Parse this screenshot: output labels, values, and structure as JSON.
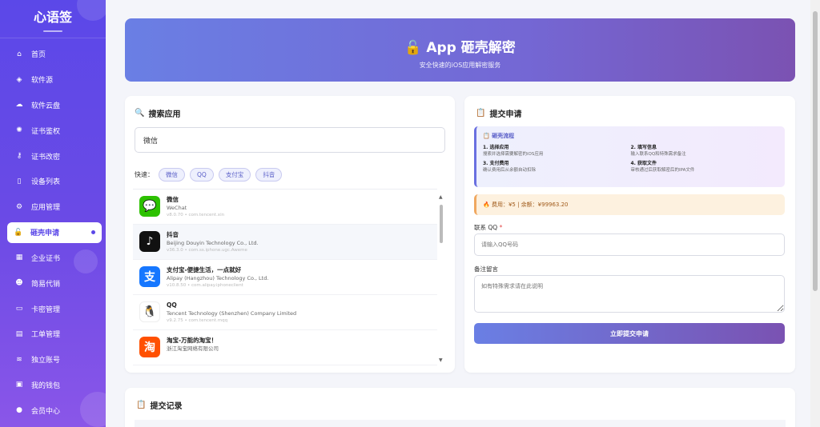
{
  "sidebar": {
    "logo": "心语签",
    "items": [
      {
        "label": "首页",
        "icon": "home-icon",
        "glyph": "⌂"
      },
      {
        "label": "软件源",
        "icon": "box-icon",
        "glyph": "◈"
      },
      {
        "label": "软件云盘",
        "icon": "cloud-icon",
        "glyph": "☁"
      },
      {
        "label": "证书鉴权",
        "icon": "certificate-icon",
        "glyph": "✺"
      },
      {
        "label": "证书改密",
        "icon": "key-icon",
        "glyph": "⚷"
      },
      {
        "label": "设备列表",
        "icon": "phone-icon",
        "glyph": "▯"
      },
      {
        "label": "应用管理",
        "icon": "apps-icon",
        "glyph": "⚙"
      },
      {
        "label": "砸壳申请",
        "icon": "unlock-icon",
        "glyph": "🔓",
        "active": true
      },
      {
        "label": "企业证书",
        "icon": "building-icon",
        "glyph": "▦"
      },
      {
        "label": "简易代销",
        "icon": "users-icon",
        "glyph": "☻"
      },
      {
        "label": "卡密管理",
        "icon": "card-icon",
        "glyph": "▭"
      },
      {
        "label": "工单管理",
        "icon": "ticket-icon",
        "glyph": "▤"
      },
      {
        "label": "独立账号",
        "icon": "layers-icon",
        "glyph": "≋"
      },
      {
        "label": "我的钱包",
        "icon": "wallet-icon",
        "glyph": "▣"
      },
      {
        "label": "会员中心",
        "icon": "user-icon",
        "glyph": "●"
      }
    ]
  },
  "hero": {
    "title": "🔓 App 砸壳解密",
    "subtitle": "安全快速的iOS应用解密服务"
  },
  "search": {
    "title": "搜索应用",
    "input_value": "微信",
    "quick_label": "快速：",
    "chips": [
      "微信",
      "QQ",
      "支付宝",
      "抖音"
    ],
    "apps": [
      {
        "name": "微信",
        "dev": "WeChat",
        "ver": "v8.0.70 • com.tencent.xin",
        "color": "#2dc100",
        "glyph": "💬"
      },
      {
        "name": "抖音",
        "dev": "Beijing Douyin Technology Co., Ltd.",
        "ver": "v36.3.0 • com.ss.iphone.ugc.Aweme",
        "color": "#111111",
        "glyph": "♪"
      },
      {
        "name": "支付宝-便捷生活，一点就好",
        "dev": "Alipay (Hangzhou) Technology Co., Ltd.",
        "ver": "v10.8.50 • com.alipay.iphoneclient",
        "color": "#1677ff",
        "glyph": "支"
      },
      {
        "name": "QQ",
        "dev": "Tencent Technology (Shenzhen) Company Limited",
        "ver": "v9.2.75 • com.tencent.mqq",
        "color": "#ffffff",
        "glyph": "🐧"
      },
      {
        "name": "淘宝-万能的淘宝！",
        "dev": "浙江淘宝网络有限公司",
        "ver": "",
        "color": "#ff5000",
        "glyph": "淘"
      }
    ]
  },
  "submit": {
    "title": "提交申请",
    "flow_title": "砸壳流程",
    "steps": [
      {
        "title": "1. 选择应用",
        "desc": "搜索并选择需要解密的iOS应用"
      },
      {
        "title": "2. 填写信息",
        "desc": "输入联系QQ和特殊需求备注"
      },
      {
        "title": "3. 支付费用",
        "desc": "确认费用后从余额自动扣除"
      },
      {
        "title": "4. 获取文件",
        "desc": "审核通过后获取解密后的IPA文件"
      }
    ],
    "fee_text": "🔥 费用：¥5 | 余额：¥99963.20",
    "qq_label": "联系 QQ",
    "qq_required": "*",
    "qq_placeholder": "请输入QQ号码",
    "note_label": "备注留言",
    "note_placeholder": "如有特殊需求请在此说明",
    "button": "立即提交申请"
  },
  "records": {
    "title": "提交记录"
  },
  "colors": {
    "accent": "#5b48e8",
    "chip_bg": "#eef0fd",
    "fee_bg": "#fdf1df"
  }
}
